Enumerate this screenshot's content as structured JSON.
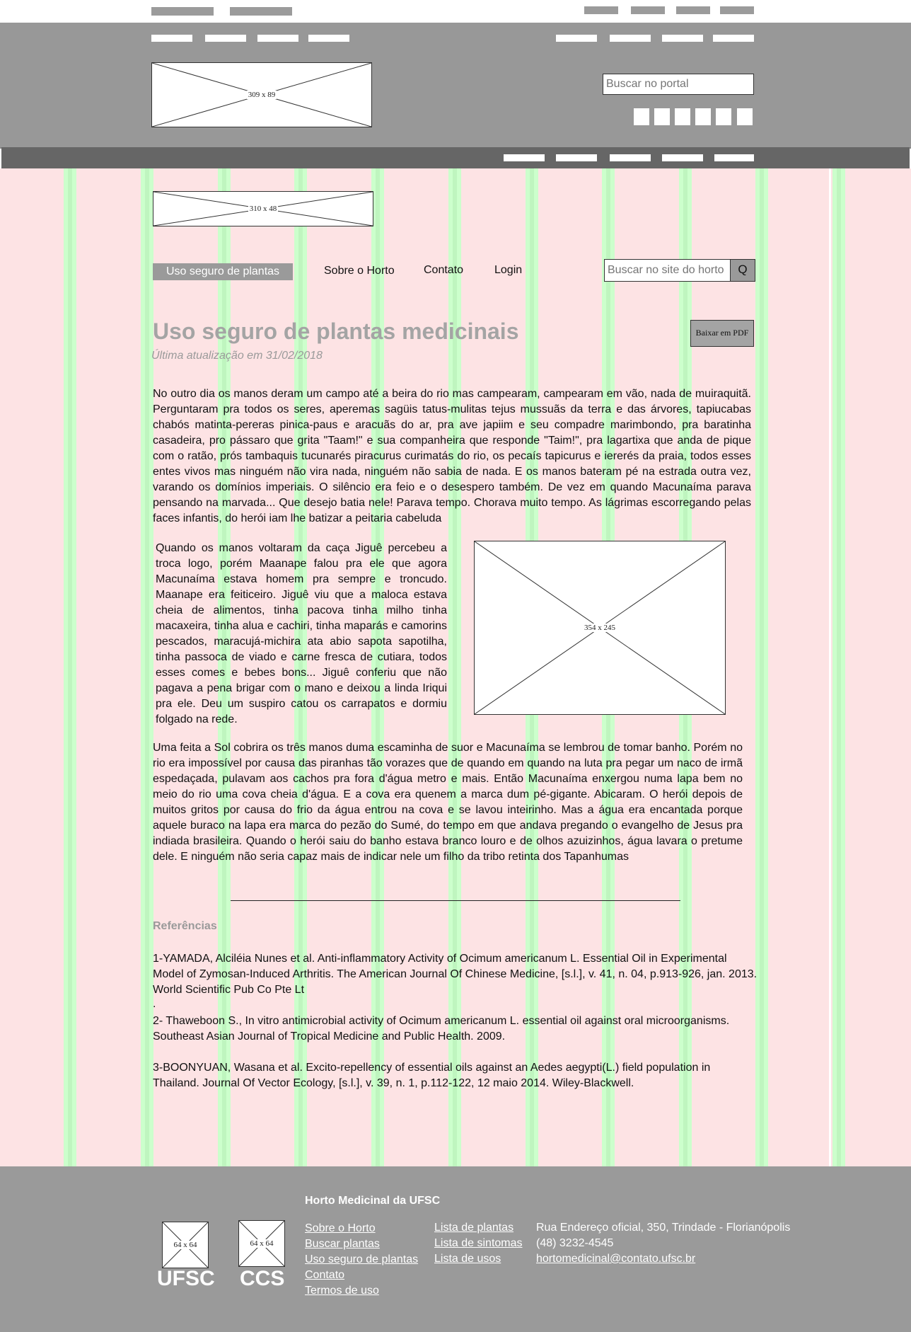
{
  "header": {
    "logo_placeholder": "309 x 89",
    "portal_search_placeholder": "Buscar no portal"
  },
  "site_logo_placeholder": "310 x 48",
  "menu": {
    "active": "Uso seguro de plantas",
    "items": [
      "Sobre o Horto",
      "Contato",
      "Login"
    ],
    "search_placeholder": "Buscar no site do horto",
    "search_button": "Q"
  },
  "page": {
    "title": "Uso seguro de plantas medicinais",
    "updated": "Última atualização em 31/02/2018",
    "pdf_button": "Baixar em PDF",
    "paragraph1": "No outro dia os manos deram um campo até a beira do rio mas campearam, campearam em vão, nada de muiraquitã. Perguntaram pra todos os seres, aperemas sagüis tatus-mulitas tejus mussuãs da terra e das árvores, tapiucabas chabós matinta-pereras pinica-paus e aracuãs do ar, pra ave japiim e seu compadre marimbondo, pra baratinha casadeira, pro pássaro que grita \"Taam!\" e sua companheira que responde \"Taim!\", pra lagartixa que anda de pique com o ratão, prós tambaquis tucunarés piracurus curimatás do rio, os pecaís tapicurus e iererés da praia, todos esses entes vivos mas ninguém não vira nada, ninguém não sabia de nada. E os manos bateram pé na estrada outra vez, varando os domínios imperiais. O silêncio era feio e o desespero também. De vez em quando Macunaíma parava pensando na marvada... Que desejo batia nele! Parava tempo. Chorava muito tempo. As lágrimas escorregando pelas faces infantis, do herói iam lhe batizar a peitaria cabeluda",
    "paragraph2": "Quando os manos voltaram da caça Jiguê percebeu a troca logo, porém Maanape falou pra ele que agora Macunaíma estava homem pra sempre e troncudo. Maanape era feiticeiro. Jiguê viu que a maloca estava cheia de alimentos, tinha pacova tinha milho tinha macaxeira, tinha alua e cachiri, tinha maparás e camorins pescados, maracujá-michira ata abio sapota sapotilha, tinha passoca de viado e carne fresca de cutiara, todos esses comes e bebes bons... Jiguê conferiu que não pagava a pena brigar com o mano e deixou a linda Iriqui pra ele. Deu um suspiro catou os carrapatos e dormiu folgado na rede.",
    "image_placeholder": "354 x 245",
    "paragraph3": "Uma feita a Sol cobrira os três manos duma escaminha de suor e Macunaíma se lembrou de tomar banho. Porém no rio era impossível por causa das piranhas tão vorazes que de quando em quando na luta pra pegar um naco de irmã espedaçada, pulavam aos cachos pra fora d'água metro e mais. Então Macunaíma enxergou numa lapa bem no meio do rio uma cova cheia d'água. E a cova era quenem a marca dum pé-gigante. Abicaram. O herói depois de muitos gritos por causa do frio da água entrou na cova e se lavou inteirinho. Mas a água era encantada porque aquele buraco na lapa era marca do pezão do Sumé, do tempo em que andava pregando o evangelho de Jesus pra indiada brasileira. Quando o herói saiu do banho estava branco louro e de olhos azuizinhos, água lavara o pretume dele. E ninguém não seria capaz mais de indicar nele um filho da tribo retinta dos Tapanhumas"
  },
  "references": {
    "title": "Referências",
    "items": [
      "1-YAMADA, Alciléia Nunes et al. Anti-inflammatory Activity of Ocimum americanum L. Essential Oil in Experimental Model of Zymosan-Induced Arthritis. The American Journal Of Chinese Medicine, [s.l.], v. 41, n. 04, p.913-926, jan. 2013. World Scientific Pub Co Pte Lt",
      ".",
      "2- Thaweboon S., In vitro antimicrobial activity of Ocimum americanum L. essential oil against oral microorganisms. Southeast Asian Journal of Tropical Medicine and Public Health. 2009.",
      "3-BOONYUAN, Wasana et al. Excito-repellency of essential oils against an Aedes aegypti(L.) field population in Thailand. Journal Of Vector Ecology, [s.l.], v. 39, n. 1, p.112-122, 12 maio 2014. Wiley-Blackwell."
    ]
  },
  "footer": {
    "heading": "Horto Medicinal da UFSC",
    "logos": [
      {
        "placeholder": "64 x 64",
        "badge": "UFSC"
      },
      {
        "placeholder": "64 x 64",
        "badge": "CCS"
      }
    ],
    "links_col1": [
      "Sobre o Horto",
      "Buscar plantas",
      "Uso seguro de plantas",
      "Contato",
      "Termos de uso"
    ],
    "links_col2": [
      "Lista de plantas",
      "Lista de sintomas",
      "Lista de usos"
    ],
    "address": "Rua Endereço oficial, 350, Trindade - Florianópolis",
    "phone": "(48) 3232-4545",
    "email": "hortomedicinal@contato.ufsc.br"
  }
}
